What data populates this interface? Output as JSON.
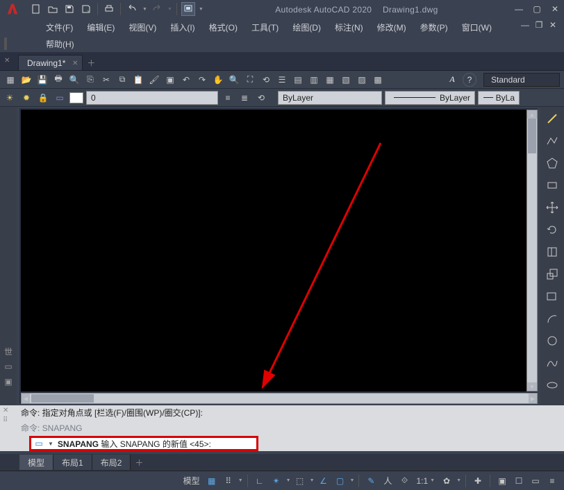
{
  "title": {
    "app": "Autodesk AutoCAD 2020",
    "doc": "Drawing1.dwg"
  },
  "menus": {
    "file": "文件(F)",
    "edit": "编辑(E)",
    "view": "视图(V)",
    "insert": "插入(I)",
    "format": "格式(O)",
    "tools": "工具(T)",
    "draw": "绘图(D)",
    "dimension": "标注(N)",
    "modify": "修改(M)",
    "parametric": "参数(P)",
    "window": "窗口(W)",
    "help": "帮助(H)"
  },
  "tabs": {
    "active": "Drawing1*"
  },
  "toolbar_top": {
    "style_label": "Standard",
    "aa": "A"
  },
  "properties": {
    "layer_zero": "0",
    "bylayer1": "ByLayer",
    "bylayer2": "ByLayer",
    "bylayer3": "ByLa"
  },
  "command": {
    "hist1": "命令: 指定对角点或 [栏选(F)/圈围(WP)/圈交(CP)]:",
    "hist2": "命令: SNAPANG",
    "prompt_cmd": "SNAPANG",
    "prompt_rest": " 输入 SNAPANG 的新值 <45>:"
  },
  "layout_tabs": {
    "model": "模型",
    "layout1": "布局1",
    "layout2": "布局2"
  },
  "status": {
    "model": "模型",
    "scale": "1:1"
  }
}
